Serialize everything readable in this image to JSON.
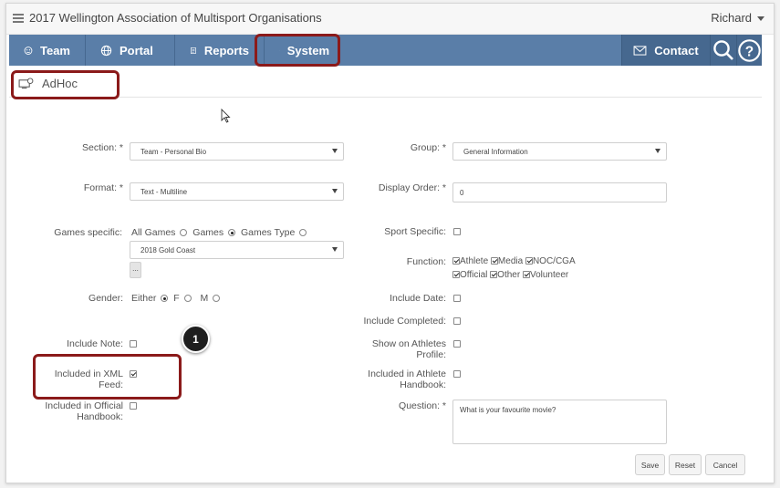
{
  "app_title": "2017 Wellington Association of Multisport Organisations",
  "user_name": "Richard",
  "nav": {
    "team": "Team",
    "portal": "Portal",
    "reports": "Reports",
    "system": "System",
    "contact": "Contact"
  },
  "page_title": "AdHoc",
  "form": {
    "section_label": "Section: *",
    "section_value": "Team - Personal Bio",
    "group_label": "Group: *",
    "group_value": "General Information",
    "format_label": "Format: *",
    "format_value": "Text - Multiline",
    "display_order_label": "Display Order: *",
    "display_order_value": "0",
    "games_specific_label": "Games specific:",
    "games_options": [
      "All Games",
      "Games",
      "Games Type"
    ],
    "games_selected": "Games",
    "games_select_value": "2018 Gold Coast",
    "games_more_button": "...",
    "sport_specific_label": "Sport Specific:",
    "function_label": "Function:",
    "function_options": [
      "Athlete",
      "Media",
      "NOC/CGA",
      "Official",
      "Other",
      "Volunteer"
    ],
    "gender_label": "Gender:",
    "gender_options": [
      "Either",
      "F",
      "M"
    ],
    "gender_selected": "Either",
    "include_date_label": "Include Date:",
    "include_completed_label": "Include Completed:",
    "include_note_label": "Include Note:",
    "show_on_athletes_profile_label_1": "Show on Athletes",
    "show_on_athletes_profile_label_2": "Profile:",
    "included_xml_label_1": "Included in XML",
    "included_xml_label_2": "Feed:",
    "included_athlete_handbook_label_1": "Included in Athlete",
    "included_athlete_handbook_label_2": "Handbook:",
    "included_official_handbook_label_1": "Included in Official",
    "included_official_handbook_label_2": "Handbook:",
    "question_label": "Question: *",
    "question_value": "What is your favourite movie?"
  },
  "buttons": {
    "save": "Save",
    "reset": "Reset",
    "cancel": "Cancel"
  },
  "callout_number": "1",
  "colors": {
    "navbar": "#5a7ea8",
    "navbar_dark": "#46688f",
    "highlight": "#8b1a1a"
  }
}
